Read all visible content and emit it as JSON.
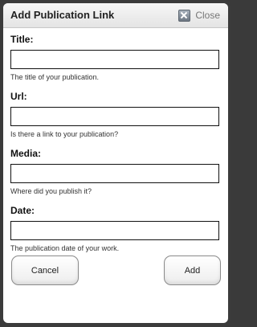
{
  "dialog": {
    "title": "Add Publication Link",
    "close_label": "Close"
  },
  "fields": [
    {
      "label": "Title:",
      "value": "",
      "help": "The title of your publication."
    },
    {
      "label": "Url:",
      "value": "",
      "help": "Is there a link to your publication?"
    },
    {
      "label": "Media:",
      "value": "",
      "help": "Where did you publish it?"
    },
    {
      "label": "Date:",
      "value": "",
      "help": "The publication date of your work."
    }
  ],
  "buttons": {
    "cancel_label": "Cancel",
    "add_label": "Add"
  }
}
